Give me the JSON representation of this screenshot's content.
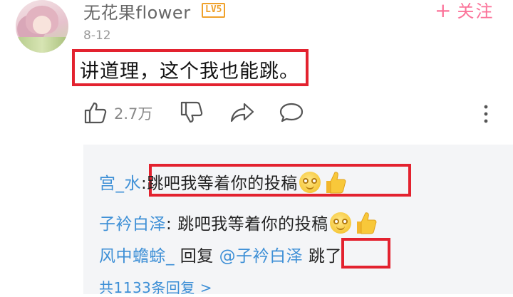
{
  "comment": {
    "username": "无花果flower",
    "level_badge": "LV5",
    "follow_label": "关注",
    "follow_icon": "plus-icon",
    "date": "8-12",
    "text": "讲道理，这个我也能跳。",
    "like_count": "2.7万"
  },
  "replies": [
    {
      "user": "宫_水",
      "separator": ":",
      "text": "跳吧我等着你的投稿"
    },
    {
      "user": "子衿白泽",
      "separator": ": ",
      "text": "跳吧我等着你的投稿"
    },
    {
      "user": "风中蟾蜍_",
      "reply_word": " 回复 ",
      "mention": "@子衿白泽",
      "text": " 跳了"
    }
  ],
  "reply_summary": "共1133条回复 >",
  "colors": {
    "accent_pink": "#fb7299",
    "link_blue": "#3d8fd6",
    "highlight_red": "#e3222f",
    "level_orange": "#f0a12a"
  }
}
